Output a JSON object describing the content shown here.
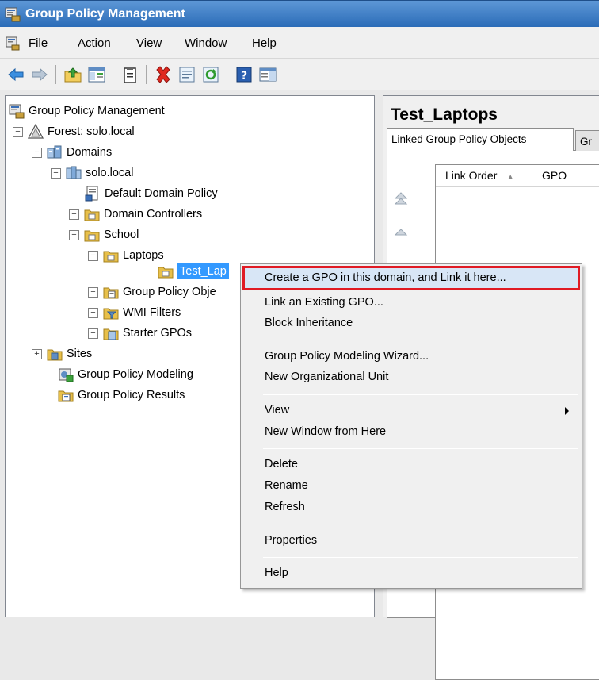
{
  "window": {
    "title": "Group Policy Management"
  },
  "menubar": {
    "items": [
      "File",
      "Action",
      "View",
      "Window",
      "Help"
    ]
  },
  "toolbar": {
    "buttons": [
      "back-icon",
      "forward-icon",
      "up-folder-icon",
      "show-hide-tree-icon",
      "clipboard-icon",
      "delete-icon",
      "properties-icon",
      "refresh-icon",
      "help-icon",
      "action-pane-icon"
    ]
  },
  "tree": {
    "root": "Group Policy Management",
    "forest": "Forest: solo.local",
    "domains": "Domains",
    "domain": "solo.local",
    "default_domain_policy": "Default Domain Policy",
    "domain_controllers": "Domain Controllers",
    "school": "School",
    "laptops": "Laptops",
    "test_laptops": "Test_Lap",
    "group_policy_objects": "Group Policy Obje",
    "wmi_filters": "WMI Filters",
    "starter_gpos": "Starter GPOs",
    "sites": "Sites",
    "modeling": "Group Policy Modeling",
    "results": "Group Policy Results"
  },
  "right_pane": {
    "title": "Test_Laptops",
    "tabs": [
      "Linked Group Policy Objects",
      "Gr"
    ],
    "columns": [
      "Link Order",
      "GPO"
    ]
  },
  "context_menu": {
    "items": [
      "Create a GPO in this domain, and Link it here...",
      "Link an Existing GPO...",
      "Block Inheritance",
      "Group Policy Modeling Wizard...",
      "New Organizational Unit",
      "View",
      "New Window from Here",
      "Delete",
      "Rename",
      "Refresh",
      "Properties",
      "Help"
    ]
  },
  "colors": {
    "titlebar": "#2b6cb8",
    "selection": "#3399ff",
    "highlight_border": "#e01b24",
    "folder": "#e8c04a"
  }
}
